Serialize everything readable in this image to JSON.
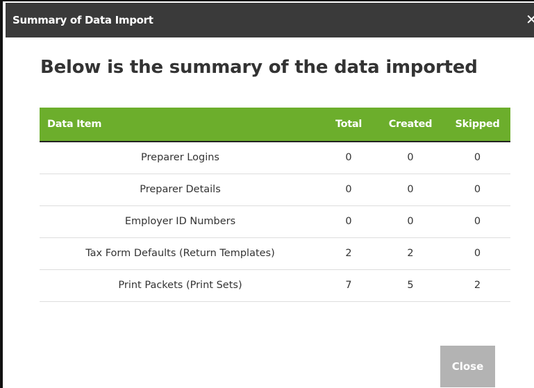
{
  "dialog": {
    "title": "Summary of Data Import",
    "close_icon": "close-icon",
    "heading": "Below is the summary of the data imported",
    "close_button_label": "Close"
  },
  "colors": {
    "titlebar": "#3a3a3a",
    "table_header": "#6cae2c",
    "close_button": "#b3b3b3"
  },
  "table": {
    "headers": [
      "Data Item",
      "Total",
      "Created",
      "Skipped"
    ],
    "rows": [
      [
        "Preparer Logins",
        "0",
        "0",
        "0"
      ],
      [
        "Preparer Details",
        "0",
        "0",
        "0"
      ],
      [
        "Employer ID Numbers",
        "0",
        "0",
        "0"
      ],
      [
        "Tax Form Defaults (Return Templates)",
        "2",
        "2",
        "0"
      ],
      [
        "Print Packets (Print Sets)",
        "7",
        "5",
        "2"
      ]
    ]
  }
}
